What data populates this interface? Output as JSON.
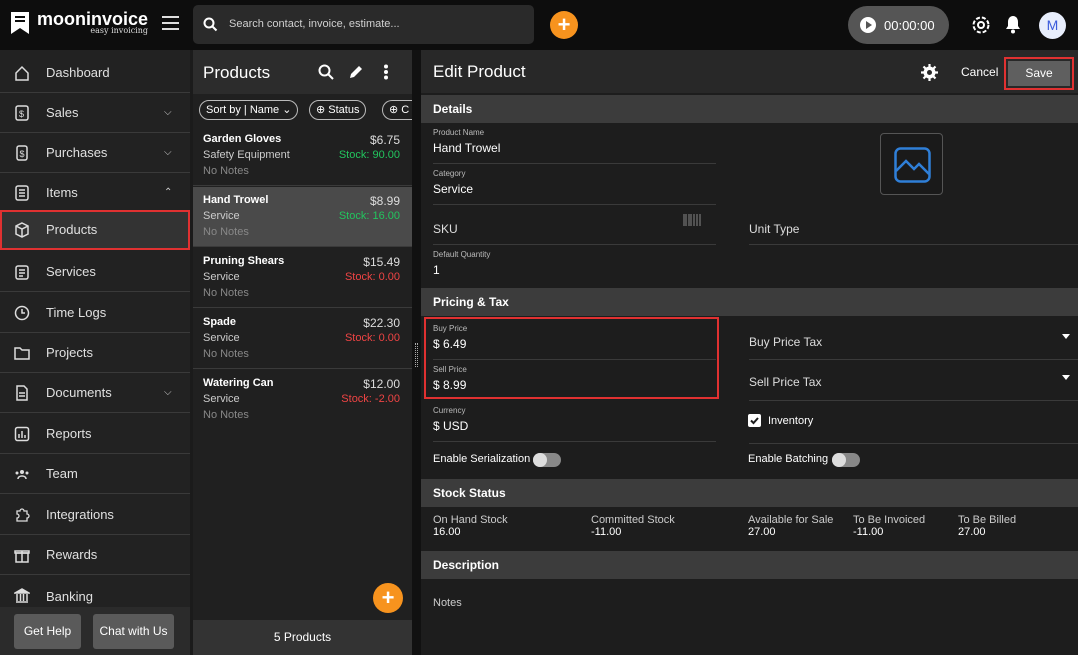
{
  "app": {
    "name": "mooninvoice",
    "tagline": "easy invoicing"
  },
  "search": {
    "placeholder": "Search contact, invoice, estimate..."
  },
  "timer": {
    "value": "00:00:00"
  },
  "user": {
    "initial": "M"
  },
  "sidebar": {
    "items": [
      {
        "label": "Dashboard"
      },
      {
        "label": "Sales"
      },
      {
        "label": "Purchases"
      },
      {
        "label": "Items"
      },
      {
        "label": "Products"
      },
      {
        "label": "Services"
      },
      {
        "label": "Time Logs"
      },
      {
        "label": "Projects"
      },
      {
        "label": "Documents"
      },
      {
        "label": "Reports"
      },
      {
        "label": "Team"
      },
      {
        "label": "Integrations"
      },
      {
        "label": "Rewards"
      },
      {
        "label": "Banking"
      }
    ],
    "help_label": "Get Help",
    "chat_label": "Chat with Us"
  },
  "products": {
    "title": "Products",
    "filters": {
      "sort": "Sort by | Name",
      "status": "Status",
      "more": "C"
    },
    "rows": [
      {
        "name": "Garden Gloves",
        "price": "$6.75",
        "category": "Safety Equipment",
        "stock": "Stock: 90.00",
        "notes": "No Notes"
      },
      {
        "name": "Hand Trowel",
        "price": "$8.99",
        "category": "Service",
        "stock": "Stock: 16.00",
        "notes": "No Notes"
      },
      {
        "name": "Pruning Shears",
        "price": "$15.49",
        "category": "Service",
        "stock": "Stock: 0.00",
        "notes": "No Notes"
      },
      {
        "name": "Spade",
        "price": "$22.30",
        "category": "Service",
        "stock": "Stock: 0.00",
        "notes": "No Notes"
      },
      {
        "name": "Watering Can",
        "price": "$12.00",
        "category": "Service",
        "stock": "Stock: -2.00",
        "notes": "No Notes"
      }
    ],
    "count_label": "5 Products"
  },
  "edit": {
    "title": "Edit Product",
    "cancel_label": "Cancel",
    "save_label": "Save",
    "details_label": "Details",
    "product_name_label": "Product Name",
    "product_name": "Hand Trowel",
    "category_label": "Category",
    "category": "Service",
    "sku_label": "SKU",
    "unit_type_label": "Unit Type",
    "default_qty_label": "Default Quantity",
    "default_qty": "1",
    "pricing_label": "Pricing & Tax",
    "buy_price_label": "Buy Price",
    "buy_price": "$ 6.49",
    "buy_tax_label": "Buy Price Tax",
    "sell_price_label": "Sell Price",
    "sell_price": "$ 8.99",
    "sell_tax_label": "Sell Price Tax",
    "currency_label": "Currency",
    "currency": "$ USD",
    "inventory_label": "Inventory",
    "serialization_label": "Enable Serialization",
    "batching_label": "Enable Batching",
    "stock_status_label": "Stock Status",
    "stock": {
      "on_hand_label": "On Hand Stock",
      "on_hand": "16.00",
      "committed_label": "Committed Stock",
      "committed": "-11.00",
      "available_label": "Available for Sale",
      "available": "27.00",
      "to_invoice_label": "To Be Invoiced",
      "to_invoice": "-11.00",
      "to_bill_label": "To Be Billed",
      "to_bill": "27.00"
    },
    "description_label": "Description",
    "notes_label": "Notes"
  },
  "colors": {
    "accent": "#f7931e",
    "positive": "#22c55e",
    "negative": "#ef4444",
    "highlight": "#e03131"
  }
}
